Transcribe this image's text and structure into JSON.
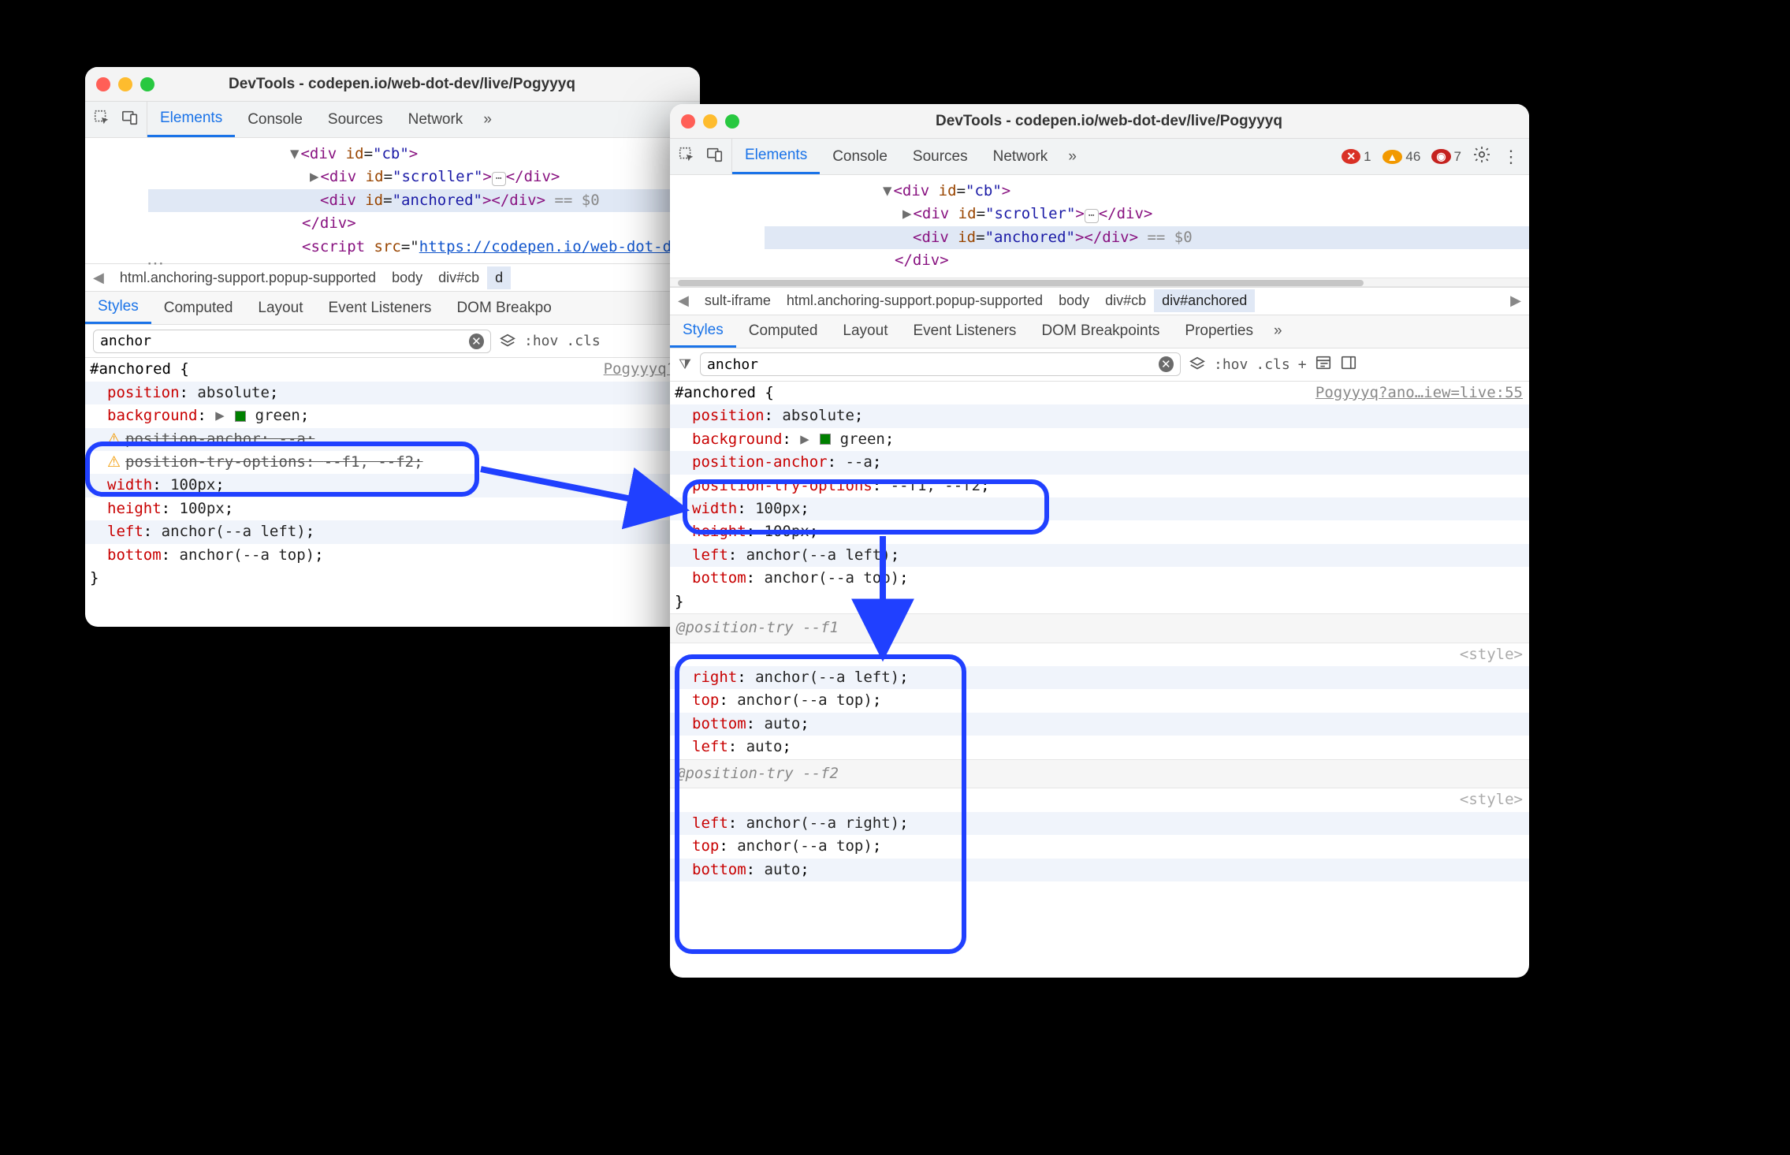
{
  "window_title": "DevTools - codepen.io/web-dot-dev/live/Pogyyyq",
  "main_tabs": {
    "elements": "Elements",
    "console": "Console",
    "sources": "Sources",
    "network": "Network"
  },
  "badges": {
    "errors": "1",
    "warnings": "46",
    "info": "7"
  },
  "elements_left": {
    "row1_open": "<div id=\"cb\">",
    "row2": "<div id=\"scroller\">…</div>",
    "row3": "<div id=\"anchored\"></div>",
    "row3_eq": "== $0",
    "row4": "</div>",
    "row5_pre": "<script src=\"",
    "row5_url": "https://codepen.io/web-dot-d",
    "twisty_down": "▼",
    "twisty_right": "▶"
  },
  "elements_right": {
    "row1_open": "<div id=\"cb\">",
    "row2": "<div id=\"scroller\">…</div>",
    "row3": "<div id=\"anchored\"></div>",
    "row3_eq": "== $0",
    "row4": "</div>"
  },
  "crumbs_left": {
    "c1": "html.anchoring-support.popup-supported",
    "c2": "body",
    "c3": "div#cb",
    "c4": "d"
  },
  "crumbs_right": {
    "c0": "sult-iframe",
    "c1": "html.anchoring-support.popup-supported",
    "c2": "body",
    "c3": "div#cb",
    "c4": "div#anchored"
  },
  "sub_tabs": {
    "styles": "Styles",
    "computed": "Computed",
    "layout": "Layout",
    "listeners": "Event Listeners",
    "dombp": "DOM Breakpoints",
    "dombp_short": "DOM Breakpo",
    "props": "Properties"
  },
  "filter_value": "anchor",
  "toolbar": {
    "hov": ":hov",
    "cls": ".cls",
    "plus": "+"
  },
  "origin_left": "Pogyyyq?an",
  "origin_right": "Pogyyyq?ano…iew=live:55",
  "selector": "#anchored {",
  "close_brace": "}",
  "style_link": "<style>",
  "rule_left": {
    "p1k": "position",
    "p1v": "absolute",
    "p2k": "background",
    "p2v": "green",
    "p3k": "position-anchor",
    "p3v": "--a",
    "p4k": "position-try-options",
    "p4v": "--f1, --f2",
    "p5k": "width",
    "p5v": "100px",
    "p6k": "height",
    "p6v": "100px",
    "p7k": "left",
    "p7v": "anchor(--a left)",
    "p8k": "bottom",
    "p8v": "anchor(--a top)"
  },
  "rule_right": {
    "p1k": "position",
    "p1v": "absolute",
    "p2k": "background",
    "p2v": "green",
    "p3k": "position-anchor",
    "p3v": "--a",
    "p4k": "position-try-options",
    "p4v": "--f1, --f2",
    "p5k": "width",
    "p5v": "100px",
    "p6k": "height",
    "p6v": "100px",
    "p7k": "left",
    "p7v": "anchor(--a left)",
    "p8k": "bottom",
    "p8v": "anchor(--a top)"
  },
  "pt1_hdr": "@position-try --f1",
  "pt1": {
    "p1k": "right",
    "p1v": "anchor(--a left)",
    "p2k": "top",
    "p2v": "anchor(--a top)",
    "p3k": "bottom",
    "p3v": "auto",
    "p4k": "left",
    "p4v": "auto"
  },
  "pt2_hdr": "@position-try --f2",
  "pt2": {
    "p1k": "left",
    "p1v": "anchor(--a right)",
    "p2k": "top",
    "p2v": "anchor(--a top)",
    "p3k": "bottom",
    "p3v": "auto"
  }
}
